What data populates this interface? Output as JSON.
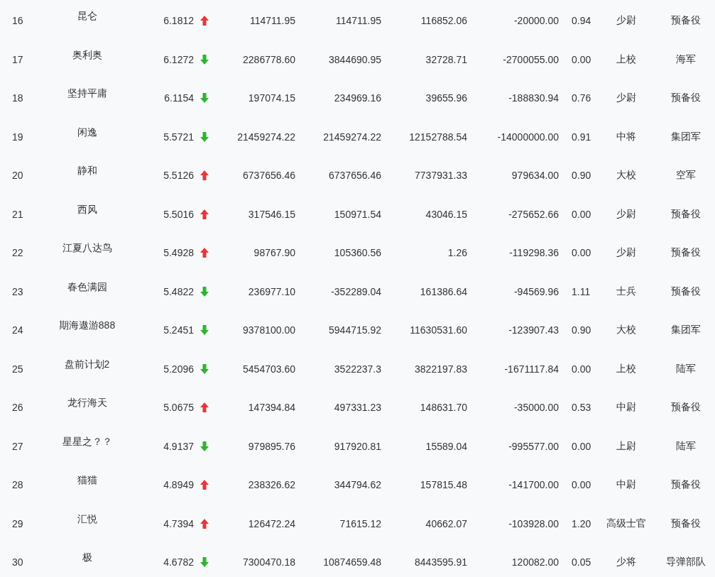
{
  "rows": [
    {
      "no": "16",
      "name": "昆仑",
      "score": "6.1812",
      "kind": "up",
      "cells": [
        "114711.95",
        "114711.95",
        "116852.06",
        "-20000.00",
        "0.94",
        "少尉",
        "预备役"
      ]
    },
    {
      "no": "17",
      "name": "奥利奥",
      "score": "6.1272",
      "kind": "down",
      "cells": [
        "2286778.60",
        "3844690.95",
        "32728.71",
        "-2700055.00",
        "0.00",
        "上校",
        "海军"
      ]
    },
    {
      "no": "18",
      "name": "坚持平庸",
      "score": "6.1154",
      "kind": "down",
      "cells": [
        "197074.15",
        "234969.16",
        "39655.96",
        "-188830.94",
        "0.76",
        "少尉",
        "预备役"
      ]
    },
    {
      "no": "19",
      "name": "闲逸",
      "score": "5.5721",
      "kind": "down",
      "cells": [
        "21459274.22",
        "21459274.22",
        "12152788.54",
        "-14000000.00",
        "0.91",
        "中将",
        "集团军"
      ]
    },
    {
      "no": "20",
      "name": "静和",
      "score": "5.5126",
      "kind": "up",
      "cells": [
        "6737656.46",
        "6737656.46",
        "7737931.33",
        "979634.00",
        "0.90",
        "大校",
        "空军"
      ]
    },
    {
      "no": "21",
      "name": "西风",
      "score": "5.5016",
      "kind": "up",
      "cells": [
        "317546.15",
        "150971.54",
        "43046.15",
        "-275652.66",
        "0.00",
        "少尉",
        "预备役"
      ]
    },
    {
      "no": "22",
      "name": "江夏八达鸟",
      "score": "5.4928",
      "kind": "up",
      "cells": [
        "98767.90",
        "105360.56",
        "1.26",
        "-119298.36",
        "0.00",
        "少尉",
        "预备役"
      ]
    },
    {
      "no": "23",
      "name": "春色满园",
      "score": "5.4822",
      "kind": "down",
      "cells": [
        "236977.10",
        "-352289.04",
        "161386.64",
        "-94569.96",
        "1.11",
        "士兵",
        "预备役"
      ]
    },
    {
      "no": "24",
      "name": "期海遨游888",
      "score": "5.2451",
      "kind": "down",
      "cells": [
        "9378100.00",
        "5944715.92",
        "11630531.60",
        "-123907.43",
        "0.90",
        "大校",
        "集团军"
      ]
    },
    {
      "no": "25",
      "name": "盘前计划2",
      "score": "5.2096",
      "kind": "down",
      "cells": [
        "5454703.60",
        "3522237.3",
        "3822197.83",
        "-1671117.84",
        "0.00",
        "上校",
        "陆军"
      ]
    },
    {
      "no": "26",
      "name": "龙行海天",
      "score": "5.0675",
      "kind": "up",
      "cells": [
        "147394.84",
        "497331.23",
        "148631.70",
        "-35000.00",
        "0.53",
        "中尉",
        "预备役"
      ]
    },
    {
      "no": "27",
      "name": "星星之？？",
      "score": "4.9137",
      "kind": "down",
      "cells": [
        "979895.76",
        "917920.81",
        "15589.04",
        "-995577.00",
        "0.00",
        "上尉",
        "陆军"
      ]
    },
    {
      "no": "28",
      "name": "猫猫",
      "score": "4.8949",
      "kind": "up",
      "cells": [
        "238326.62",
        "344794.62",
        "157815.48",
        "-141700.00",
        "0.00",
        "中尉",
        "预备役"
      ]
    },
    {
      "no": "29",
      "name": "汇悦",
      "score": "4.7394",
      "kind": "up",
      "cells": [
        "126472.24",
        "71615.12",
        "40662.07",
        "-103928.00",
        "1.20",
        "高级士官",
        "预备役"
      ]
    },
    {
      "no": "30",
      "name": "极",
      "score": "4.6782",
      "kind": "down",
      "cells": [
        "7300470.18",
        "10874659.48",
        "8443595.91",
        "120082.00",
        "0.05",
        "少将",
        "导弹部队"
      ]
    }
  ]
}
